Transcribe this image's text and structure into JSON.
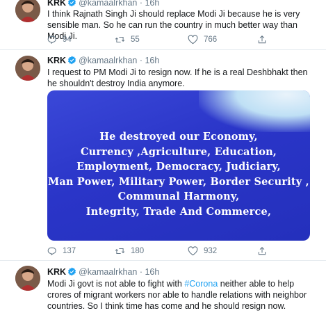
{
  "tweets": [
    {
      "name": "KRK",
      "handle": "@kamaalrkhan",
      "time": "16h",
      "text": "I think Rajnath Singh Ji should replace Modi Ji because he is very sensible man. So he can run the country in much better way than Modi Ji.",
      "replies": "94",
      "retweets": "55",
      "likes": "766"
    },
    {
      "name": "KRK",
      "handle": "@kamaalrkhan",
      "time": "16h",
      "text": "I request to PM Modi Ji to resign now. If he is a real Deshbhakt then he shouldn't destroy India anymore.",
      "media_lines": [
        "He destroyed our Economy,",
        "Currency ,Agriculture, Education,",
        "Employment, Democracy, Judiciary,",
        "Man Power, Military Power, Border Security ,",
        "Communal Harmony,",
        "Integrity, Trade And Commerce,"
      ],
      "replies": "137",
      "retweets": "180",
      "likes": "932"
    },
    {
      "name": "KRK",
      "handle": "@kamaalrkhan",
      "time": "16h",
      "text_before": "Modi Ji govt is not able to fight with ",
      "hashtag": "#Corona",
      "text_after": " neither able to help crores of migrant workers nor able to handle relations with neighbor countries. So I think time has come and he should resign now."
    }
  ],
  "colors": {
    "accent": "#1da1f2",
    "muted": "#657786",
    "media_bg": "#2a35c8"
  },
  "icons": [
    "reply-icon",
    "retweet-icon",
    "like-icon",
    "share-icon",
    "verified-icon"
  ]
}
